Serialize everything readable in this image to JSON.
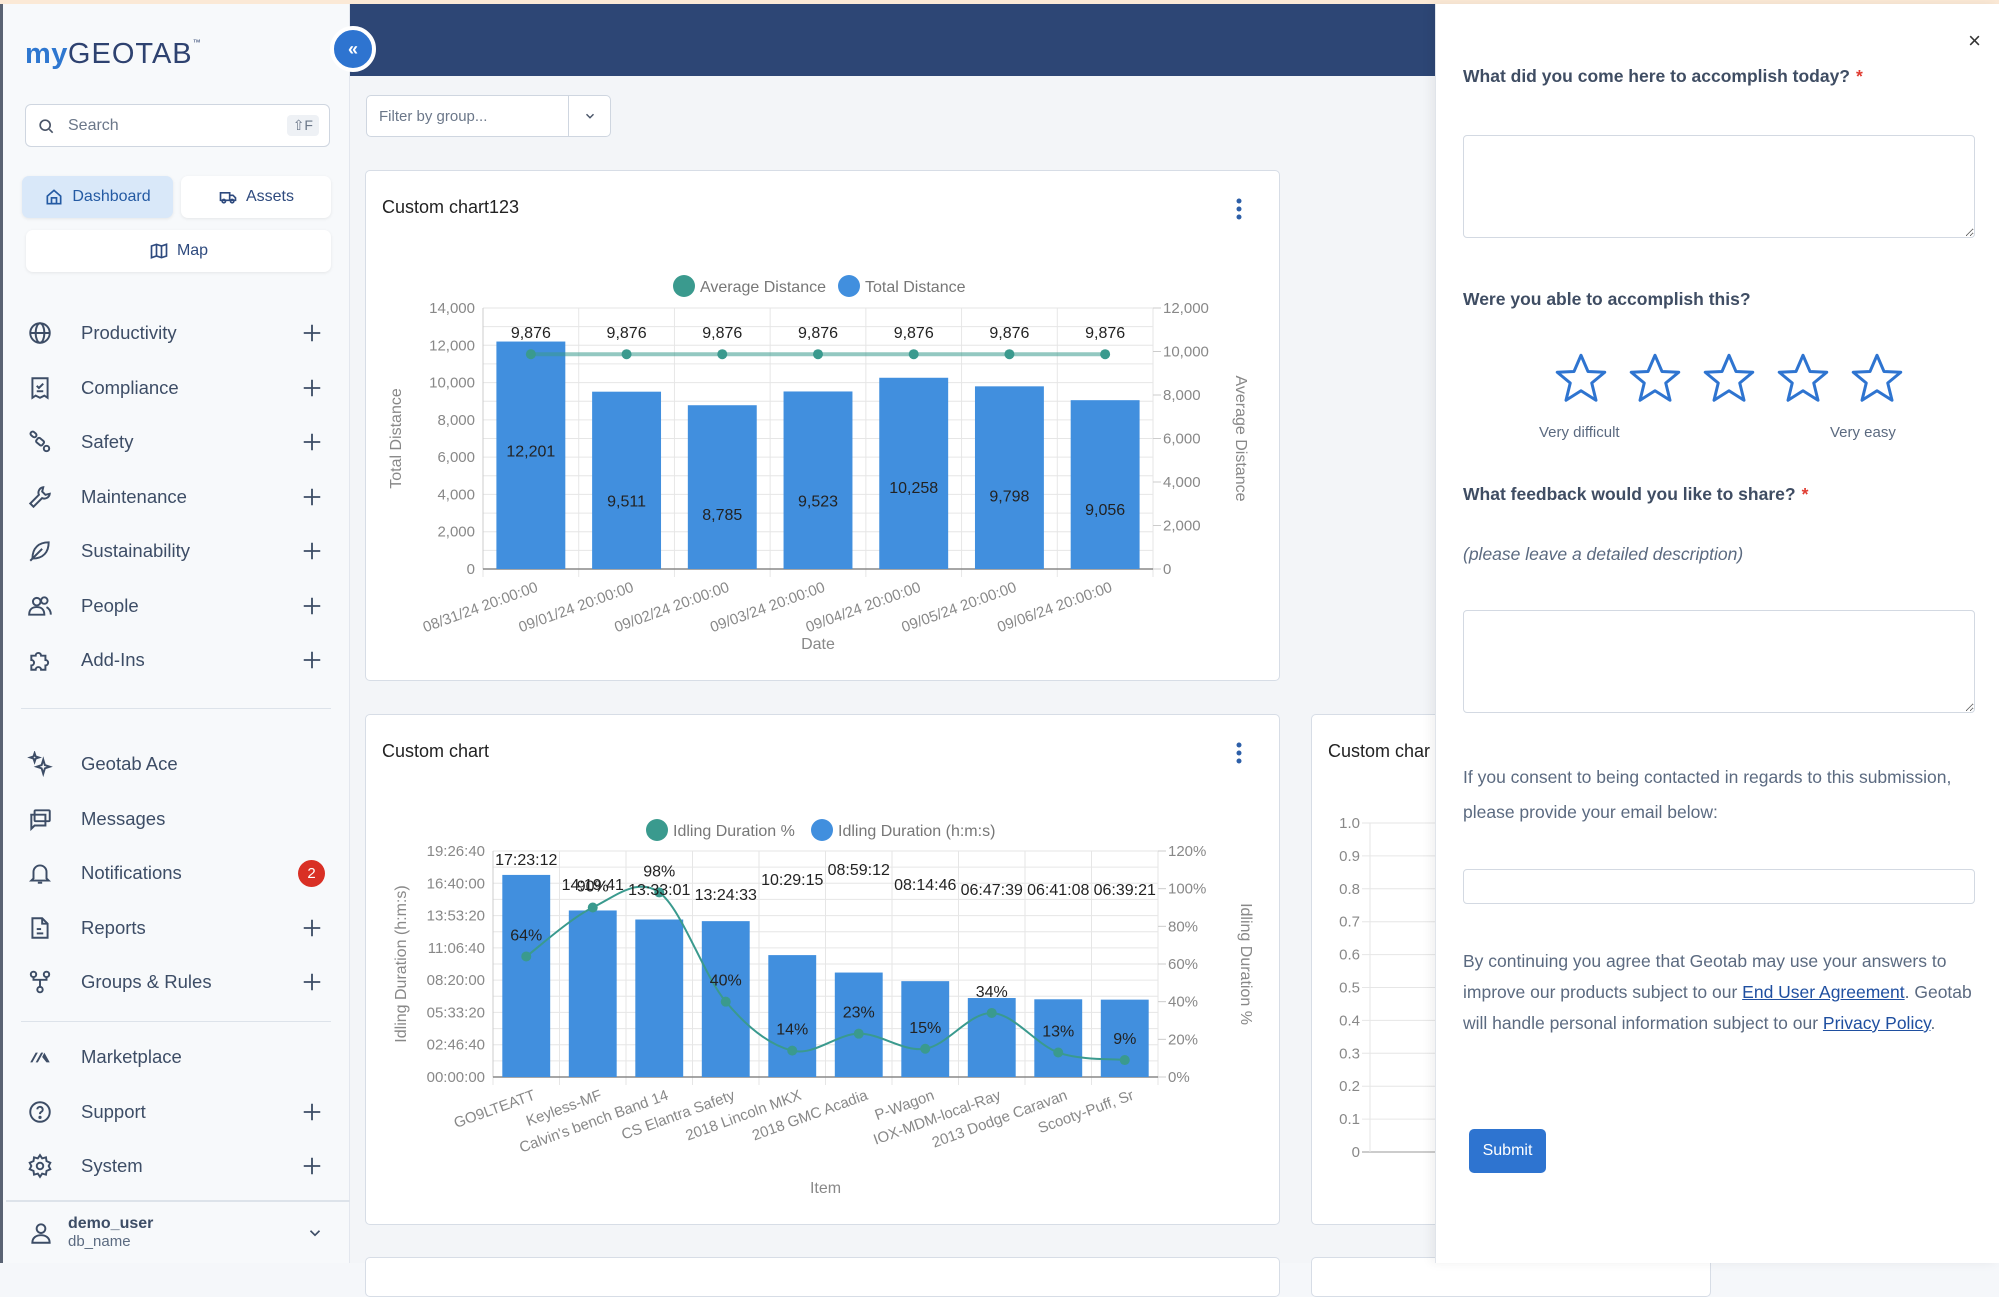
{
  "app": {
    "logo_my": "my",
    "logo_geotab": "GEOTAB",
    "logo_tm": "™",
    "collapse_icon": "double-chevron-left-icon",
    "collapse_label": "«"
  },
  "search": {
    "placeholder": "Search",
    "shortcut": "⇧F"
  },
  "quick_nav": [
    {
      "label": "Dashboard",
      "icon": "home-icon",
      "active": true
    },
    {
      "label": "Assets",
      "icon": "truck-icon",
      "active": false
    },
    {
      "label": "Map",
      "icon": "map-icon",
      "active": false
    }
  ],
  "sidebar": {
    "group1": [
      {
        "label": "Productivity",
        "icon": "globe-icon",
        "expand": true
      },
      {
        "label": "Compliance",
        "icon": "receipt-icon",
        "expand": true
      },
      {
        "label": "Safety",
        "icon": "seatbelt-icon",
        "expand": true
      },
      {
        "label": "Maintenance",
        "icon": "wrench-icon",
        "expand": true
      },
      {
        "label": "Sustainability",
        "icon": "leaf-icon",
        "expand": true
      },
      {
        "label": "People",
        "icon": "people-icon",
        "expand": true
      },
      {
        "label": "Add-Ins",
        "icon": "puzzle-icon",
        "expand": true
      }
    ],
    "group2": [
      {
        "label": "Geotab Ace",
        "icon": "sparkle-icon",
        "expand": false
      },
      {
        "label": "Messages",
        "icon": "messages-icon",
        "expand": false
      },
      {
        "label": "Notifications",
        "icon": "bell-icon",
        "expand": false,
        "badge": "2"
      },
      {
        "label": "Reports",
        "icon": "document-icon",
        "expand": true
      },
      {
        "label": "Groups & Rules",
        "icon": "hierarchy-icon",
        "expand": true
      }
    ],
    "group3": [
      {
        "label": "Marketplace",
        "icon": "marketplace-icon",
        "expand": false
      },
      {
        "label": "Support",
        "icon": "help-circle-icon",
        "expand": true
      },
      {
        "label": "System",
        "icon": "gear-icon",
        "expand": true
      }
    ],
    "user": {
      "name": "demo_user",
      "database": "db_name"
    }
  },
  "filter": {
    "placeholder": "Filter by group..."
  },
  "cards": [
    {
      "title": "Custom chart123"
    },
    {
      "title": "Custom chart"
    },
    {
      "title": "Custom char"
    }
  ],
  "chart_data": [
    {
      "type": "bar",
      "title": "Custom chart123",
      "xlabel": "Date",
      "ylabel": "Total Distance",
      "y2label": "Average Distance",
      "categories": [
        "08/31/24 20:00:00",
        "09/01/24 20:00:00",
        "09/02/24 20:00:00",
        "09/03/24 20:00:00",
        "09/04/24 20:00:00",
        "09/05/24 20:00:00",
        "09/06/24 20:00:00"
      ],
      "series": [
        {
          "name": "Total Distance",
          "kind": "bar",
          "axis": "left",
          "color": "#418fde",
          "values": [
            12201,
            9511,
            8785,
            9523,
            10258,
            9798,
            9056
          ],
          "labels": [
            "12,201",
            "9,511",
            "8,785",
            "9,523",
            "10,258",
            "9,798",
            "9,056"
          ]
        },
        {
          "name": "Average Distance",
          "kind": "line",
          "axis": "right",
          "color": "#3a9a8e",
          "values": [
            9876,
            9876,
            9876,
            9876,
            9876,
            9876,
            9876
          ],
          "labels": [
            "9,876",
            "9,876",
            "9,876",
            "9,876",
            "9,876",
            "9,876",
            "9,876"
          ]
        }
      ],
      "legend": [
        "Average Distance",
        "Total Distance"
      ],
      "legend_position": "top",
      "ylim": [
        0,
        14000
      ],
      "yticks": [
        "0",
        "2,000",
        "4,000",
        "6,000",
        "8,000",
        "10,000",
        "12,000",
        "14,000"
      ],
      "y2lim": [
        0,
        12000
      ],
      "y2ticks": [
        "0",
        "2,000",
        "4,000",
        "6,000",
        "8,000",
        "10,000",
        "12,000"
      ],
      "grid": true
    },
    {
      "type": "bar",
      "title": "Custom chart",
      "xlabel": "Item",
      "ylabel": "Idling Duration (h:m:s)",
      "y2label": "Idling Duration %",
      "categories": [
        "GO9LTEATT",
        "Keyless-MF",
        "Calvin's bench Band 14",
        "CS Elantra Safety",
        "2018 Lincoln MKX",
        "2018 GMC Acadia",
        "P-Wagon",
        "IOX-MDM-local-Ray",
        "2013 Dodge Caravan",
        "Scooty-Puff, Sr"
      ],
      "series": [
        {
          "name": "Idling Duration (h:m:s)",
          "kind": "bar",
          "axis": "left",
          "color": "#418fde",
          "values_seconds": [
            62592,
            51581,
            48781,
            48273,
            37755,
            32352,
            29686,
            24459,
            24068,
            23961
          ],
          "labels": [
            "17:23:12",
            "14:19:41",
            "13:33:01",
            "13:24:33",
            "10:29:15",
            "08:59:12",
            "08:14:46",
            "06:47:39",
            "06:41:08",
            "06:39:21"
          ]
        },
        {
          "name": "Idling Duration %",
          "kind": "line",
          "axis": "right",
          "color": "#3a9a8e",
          "values": [
            64,
            90,
            98,
            40,
            14,
            23,
            15,
            34,
            13,
            9
          ],
          "labels": [
            "64%",
            "90%",
            "98%",
            "40%",
            "14%",
            "23%",
            "15%",
            "34%",
            "13%",
            "9%"
          ]
        }
      ],
      "legend": [
        "Idling Duration %",
        "Idling Duration (h:m:s)"
      ],
      "legend_position": "top",
      "ylim_seconds": [
        0,
        70000
      ],
      "yticks": [
        "00:00:00",
        "02:46:40",
        "05:33:20",
        "08:20:00",
        "11:06:40",
        "13:53:20",
        "16:40:00",
        "19:26:40"
      ],
      "y2lim": [
        0,
        120
      ],
      "y2ticks": [
        "0%",
        "20%",
        "40%",
        "60%",
        "80%",
        "100%",
        "120%"
      ],
      "grid": true
    },
    {
      "type": "line",
      "title": "Custom char",
      "ylim": [
        0,
        1.0
      ],
      "yticks": [
        "0",
        "0.1",
        "0.2",
        "0.3",
        "0.4",
        "0.5",
        "0.6",
        "0.7",
        "0.8",
        "0.9",
        "1.0"
      ],
      "series": [],
      "grid": true
    }
  ],
  "feedback": {
    "close_label": "×",
    "q1": "What did you come here to accomplish today?",
    "q2": "Were you able to accomplish this?",
    "rating": {
      "value": 0,
      "max": 5,
      "low_label": "Very difficult",
      "high_label": "Very easy"
    },
    "q3": "What feedback would you like to share?",
    "q3_hint": "(please leave a detailed description)",
    "required_mark": "*",
    "consent": "If you consent to being contacted in regards to this submission, please provide your email below:",
    "email_value": "",
    "legal_1": "By continuing you agree that Geotab may use your answers to improve our products subject to our ",
    "eula_link": "End User Agreement",
    "legal_2": ". Geotab will handle personal information subject to our ",
    "privacy_link": "Privacy Policy",
    "legal_3": ".",
    "submit_label": "Submit"
  }
}
